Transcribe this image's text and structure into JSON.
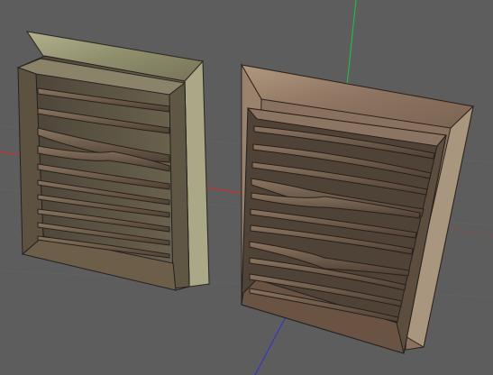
{
  "viewport": {
    "background": "#5d5d5d",
    "grid_color": "#6b6b6b",
    "axes": {
      "x": "#d42a2a",
      "y": "#22c23a",
      "z": "#3030d8"
    }
  },
  "scene": {
    "objects": [
      {
        "name": "louvered-vent-left",
        "frame_color": "#9c9a78",
        "slat_color": "#6b5848",
        "slat_count": 11
      },
      {
        "name": "louvered-vent-right",
        "frame_color": "#9a7f6c",
        "slat_color": "#6a5446",
        "slat_count": 11
      }
    ]
  }
}
